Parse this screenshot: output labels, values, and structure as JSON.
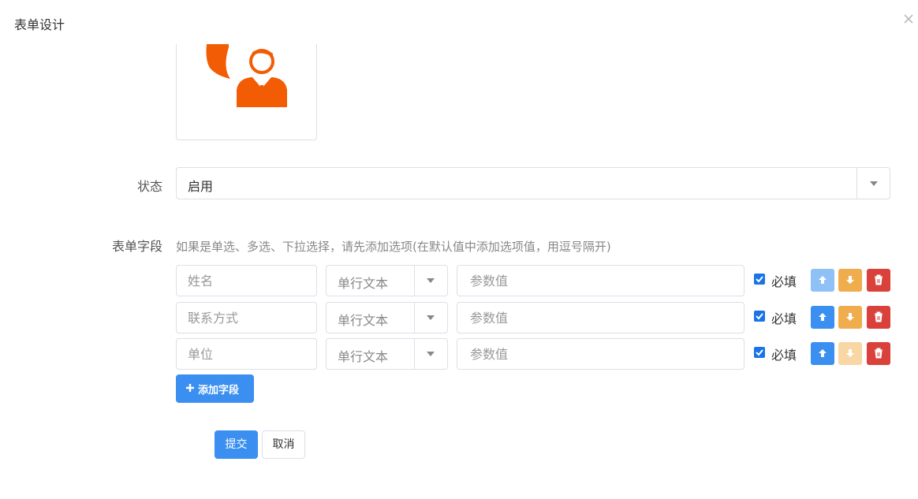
{
  "dialog": {
    "title": "表单设计",
    "close_icon": "close-icon"
  },
  "colors": {
    "primary": "#3b8ff0",
    "warning": "#f0ad4e",
    "danger": "#d9413a",
    "icon_orange": "#f25c05"
  },
  "status": {
    "label": "状态",
    "value": "启用"
  },
  "fields": {
    "label": "表单字段",
    "hint": "如果是单选、多选、下拉选择，请先添加选项(在默认值中添加选项值，用逗号隔开)",
    "required_label": "必填",
    "param_placeholder": "参数值",
    "rows": [
      {
        "name": "姓名",
        "type": "单行文本",
        "required": true,
        "up_disabled": true,
        "down_disabled": false
      },
      {
        "name": "联系方式",
        "type": "单行文本",
        "required": true,
        "up_disabled": false,
        "down_disabled": false
      },
      {
        "name": "单位",
        "type": "单行文本",
        "required": true,
        "up_disabled": false,
        "down_disabled": true
      }
    ],
    "add_label": "添加字段"
  },
  "actions": {
    "submit": "提交",
    "cancel": "取消"
  }
}
